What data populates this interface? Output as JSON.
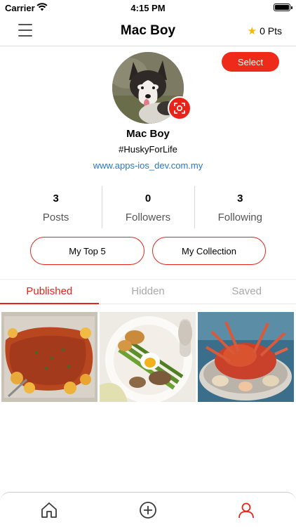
{
  "status_bar": {
    "carrier": "Carrier",
    "time": "4:15 PM"
  },
  "nav": {
    "title": "Mac Boy",
    "points": "0 Pts"
  },
  "profile": {
    "select_label": "Select",
    "name": "Mac Boy",
    "tagline": "#HuskyForLife",
    "link": "www.apps-ios_dev.com.my"
  },
  "stats": [
    {
      "value": "3",
      "label": "Posts"
    },
    {
      "value": "0",
      "label": "Followers"
    },
    {
      "value": "3",
      "label": "Following"
    }
  ],
  "buttons": {
    "top5": "My Top 5",
    "collection": "My Collection"
  },
  "tabs": [
    {
      "label": "Published",
      "active": true
    },
    {
      "label": "Hidden",
      "active": false
    },
    {
      "label": "Saved",
      "active": false
    }
  ],
  "photos": [
    "baked-salmon-photo",
    "salad-egg-photo",
    "seafood-platter-photo"
  ],
  "bottom_tabs": [
    "home-icon",
    "add-icon",
    "profile-icon"
  ],
  "colors": {
    "accent": "#e8241a",
    "link": "#2778c4",
    "star": "#f6b800"
  }
}
